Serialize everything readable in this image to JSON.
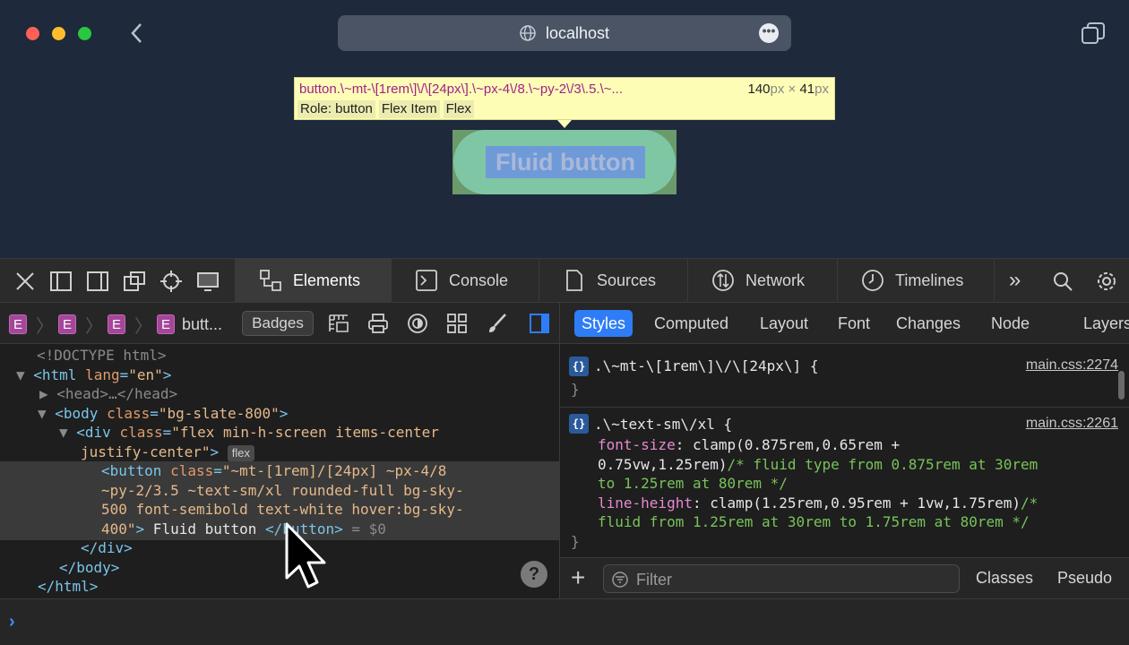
{
  "browser": {
    "url": "localhost",
    "colors": {
      "red": "#fe5f57",
      "yellow": "#febc2e",
      "green": "#28c840"
    }
  },
  "inspector_tooltip": {
    "selector": "button.\\~mt-\\[1rem\\]\\/\\[24px\\].\\~px-4\\/8.\\~py-2\\/3\\.5.\\~...",
    "width": "140",
    "height": "41",
    "unit": "px",
    "times": "×",
    "role": "Role: button",
    "badge_flex_item": "Flex Item",
    "badge_flex": "Flex"
  },
  "page_button": {
    "label": "Fluid button"
  },
  "devtools": {
    "tabs": [
      {
        "label": "Elements",
        "icon": "elements-icon"
      },
      {
        "label": "Console",
        "icon": "console-icon"
      },
      {
        "label": "Sources",
        "icon": "sources-icon"
      },
      {
        "label": "Network",
        "icon": "network-icon"
      },
      {
        "label": "Timelines",
        "icon": "timelines-icon"
      }
    ],
    "more": "»"
  },
  "breadcrumb": {
    "e": "E",
    "last": "butt..."
  },
  "badges_label": "Badges",
  "dom": {
    "doctype": "<!DOCTYPE html>",
    "html_open_tag": "<html",
    "html_attr": "lang",
    "html_val": "\"en\"",
    "head": "<head>…</head>",
    "body_attr": "class",
    "body_val": "\"bg-slate-800\"",
    "div_val_1": "\"flex min-h-screen items-center",
    "div_val_2": "justify-center\"",
    "flex_badge": "flex",
    "button_val_1": "\"~mt-[1rem]/[24px] ~px-4/8",
    "button_val_2": "~py-2/3.5 ~text-sm/xl rounded-full bg-sky-",
    "button_val_3": "500 font-semibold text-white hover:bg-sky-",
    "button_val_4": "400\"",
    "button_text": " Fluid button ",
    "dollar": " = $0",
    "div_close": "</div>",
    "body_close": "</body>",
    "html_close": "</html>"
  },
  "side_tabs": [
    "Styles",
    "Computed",
    "Layout",
    "Font",
    "Changes",
    "Node",
    "Layers"
  ],
  "styles": {
    "rule1_selector": ".\\~mt-\\[1rem\\]\\/\\[24px\\] {",
    "rule1_src": "main.css:2274",
    "rule2_selector": ".\\~text-sm\\/xl {",
    "rule2_src": "main.css:2261",
    "p1_name": "font-size",
    "p1_val_a": "clamp(0.875rem,0.65rem +",
    "p1_val_b": "0.75vw,1.25rem)",
    "p1_cm_a": "/* fluid type from 0.875rem at 30rem",
    "p1_cm_b": "to 1.25rem at 80rem */",
    "p2_name": "line-height",
    "p2_val": "clamp(1.25rem,0.95rem + 1vw,1.75rem)",
    "p2_cm_a": "/*",
    "p2_cm_b": "fluid from 1.25rem at 30rem to 1.75rem at 80rem */"
  },
  "filter": {
    "placeholder": "Filter",
    "classes": "Classes",
    "pseudo": "Pseudo"
  },
  "console": {
    "prompt": "›"
  }
}
